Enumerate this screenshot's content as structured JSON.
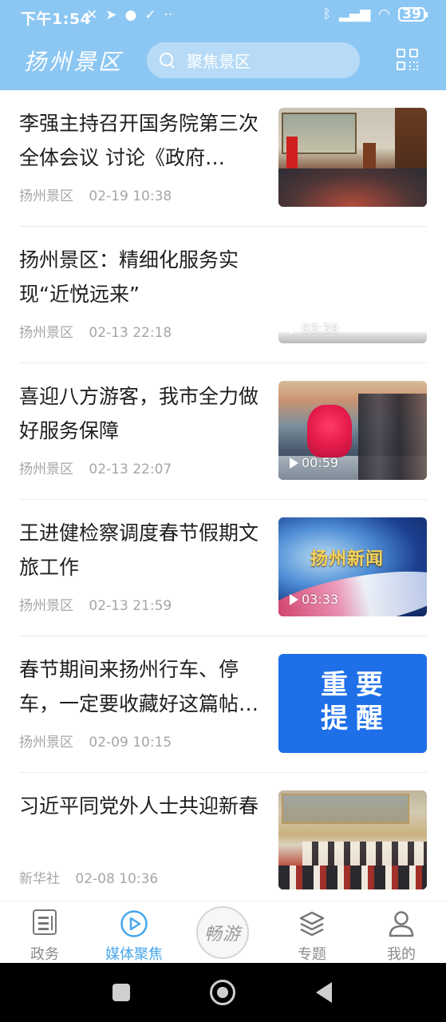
{
  "status_bar": {
    "time": "下午1:54",
    "battery": "39",
    "icons": [
      "mute-icon",
      "telegram-icon",
      "chat-icon",
      "check-icon",
      "more-dots-icon",
      "bluetooth-icon",
      "signal-icon",
      "wifi-icon",
      "battery-icon"
    ]
  },
  "header": {
    "logo_text": "扬州景区",
    "search_placeholder": "聚焦景区",
    "qr_icon": "qr-code-icon",
    "background_color": "#8cc7f3"
  },
  "news": [
    {
      "title": "李强主持召开国务院第三次全体会议 讨论《政府…",
      "source": "扬州景区",
      "time": "02-19 10:38",
      "thumb": "meeting-photo",
      "duration": ""
    },
    {
      "title": "扬州景区：精细化服务实现“近悦远来”",
      "source": "扬州景区",
      "time": "02-13 22:18",
      "thumb": "video-thumb",
      "duration": "03:39"
    },
    {
      "title": "喜迎八方游客，我市全力做好服务保障",
      "source": "扬州景区",
      "time": "02-13 22:07",
      "thumb": "lion-dance-photo",
      "duration": "00:59"
    },
    {
      "title": "王进健检察调度春节假期文旅工作",
      "source": "扬州景区",
      "time": "02-13 21:59",
      "thumb": "yangzhou-news-video",
      "thumb_text": "扬州新闻",
      "duration": "03:33"
    },
    {
      "title": "春节期间来扬州行车、停车，一定要收藏好这篇帖…",
      "source": "扬州景区",
      "time": "02-09 10:15",
      "thumb": "important-notice-card",
      "thumb_text": "重要提醒",
      "duration": ""
    },
    {
      "title": "习近平同党外人士共迎新春",
      "source": "新华社",
      "time": "02-08 10:36",
      "thumb": "reception-hall-photo",
      "duration": ""
    }
  ],
  "bottom_nav": {
    "tabs": [
      {
        "label": "政务",
        "icon": "document-icon",
        "active": false
      },
      {
        "label": "媒体聚焦",
        "icon": "play-circle-icon",
        "active": true
      },
      {
        "label": "畅游",
        "icon": "changyou-badge-icon",
        "active": false
      },
      {
        "label": "专题",
        "icon": "layers-icon",
        "active": false
      },
      {
        "label": "我的",
        "icon": "user-icon",
        "active": false
      }
    ],
    "active_color": "#47a7ec"
  },
  "system_nav": {
    "buttons": [
      "recent-apps-icon",
      "home-icon",
      "back-icon"
    ]
  }
}
